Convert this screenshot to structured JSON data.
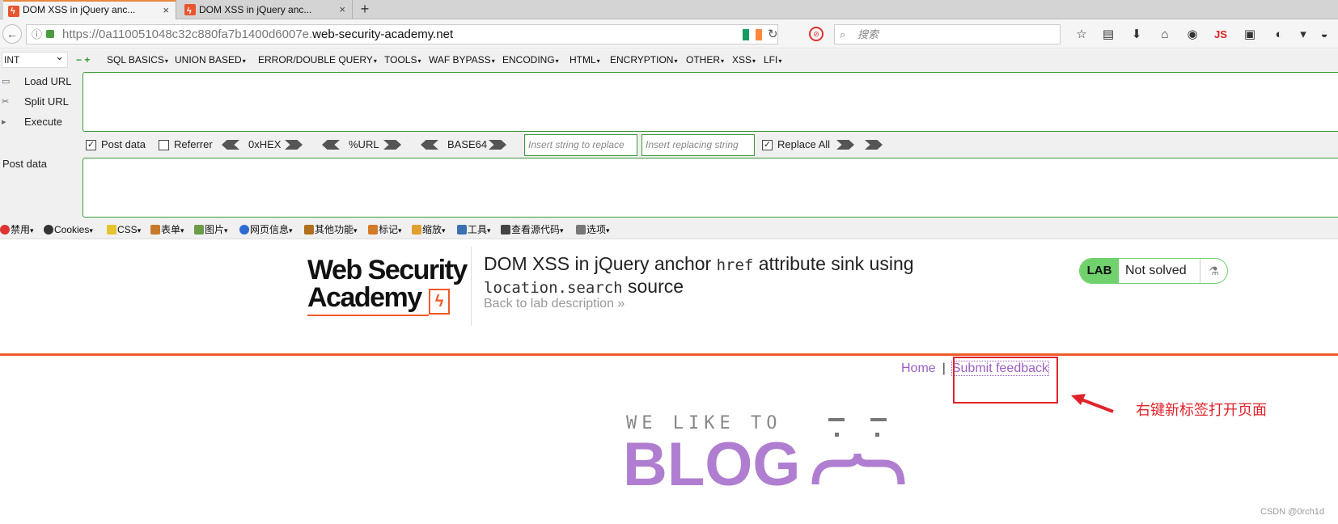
{
  "tabs": [
    {
      "title": "DOM XSS in jQuery anc...",
      "close": "×"
    },
    {
      "title": "DOM XSS in jQuery anc...",
      "close": "×"
    }
  ],
  "new_tab": "+",
  "navbar": {
    "back": "←",
    "url_prefix": "https://0a110051048c32c880fa7b1400d6007e.",
    "url_domain": "web-security-academy.net",
    "reload": "↻",
    "search_placeholder": "搜索",
    "search_icon": "search-icon",
    "js_label": "JS"
  },
  "hackbar": {
    "select_value": "INT",
    "plus_minus": "−  +",
    "menu": [
      "SQL BASICS",
      "UNION BASED",
      "ERROR/DOUBLE QUERY",
      "TOOLS",
      "WAF BYPASS",
      "ENCODING",
      "HTML",
      "ENCRYPTION",
      "OTHER",
      "XSS",
      "LFI"
    ],
    "load_url": "Load URL",
    "split_url": "Split URL",
    "execute": "Execute",
    "post_data_checked": true,
    "post_data_label": "Post data",
    "referrer_checked": false,
    "referrer_label": "Referrer",
    "hex_label": "0xHEX",
    "url_label": "%URL",
    "base64_label": "BASE64",
    "replace_placeholder": "Insert string to replace",
    "replacing_placeholder": "Insert replacing string",
    "replace_all_checked": true,
    "replace_all_label": "Replace All",
    "post_data_area_label": "Post data"
  },
  "devbar": {
    "items": [
      "禁用",
      "Cookies",
      "CSS",
      "表单",
      "图片",
      "网页信息",
      "其他功能",
      "标记",
      "缩放",
      "工具",
      "查看源代码",
      "选项"
    ]
  },
  "page": {
    "logo_line1": "Web Security",
    "logo_line2": "Academy",
    "title_part1": "DOM XSS in jQuery anchor ",
    "title_code1": "href",
    "title_part2": " attribute sink using",
    "title_code2": "location.search",
    "title_part3": " source",
    "back_link": "Back to lab description »",
    "lab_label": "LAB",
    "lab_status": "Not solved",
    "nav_home": "Home",
    "nav_sep": "|",
    "nav_feedback": "Submit feedback",
    "annotation": "右键新标签打开页面",
    "blog_small": "WE LIKE TO",
    "blog_big": "BLOG",
    "watermark": "CSDN @0rch1d"
  },
  "colors": {
    "accent_orange": "#f05a28",
    "lab_green": "#70d16d",
    "link_purple": "#9b5fc0",
    "annotation_red": "#e0232b"
  }
}
